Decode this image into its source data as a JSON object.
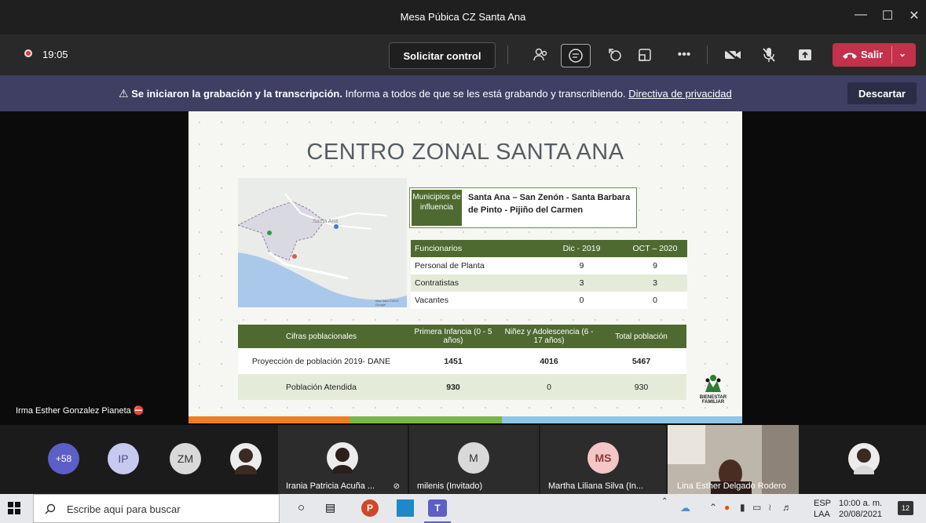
{
  "window": {
    "title": "Mesa Púbica CZ Santa Ana"
  },
  "toolbar": {
    "timer": "19:05",
    "request_control": "Solicitar control",
    "leave": "Salir"
  },
  "banner": {
    "bold": "Se iniciaron la grabación y la transcripción.",
    "text": "Informa a todos de que se les está grabando y transcribiendo.",
    "link": "Directiva de privacidad",
    "dismiss": "Descartar"
  },
  "slide": {
    "title": "CENTRO ZONAL SANTA ANA",
    "municipios_label": "Municipios de influencia",
    "municipios_value": "Santa Ana – San Zenón - Santa Barbara de Pinto - Pijiño del Carmen",
    "map_credit": "Map data ©2019 Google",
    "map_labels": [
      "Santa Ana"
    ],
    "funcionarios": {
      "headers": [
        "Funcionarios",
        "Dic - 2019",
        "OCT – 2020"
      ],
      "rows": [
        [
          "Personal de Planta",
          "9",
          "9"
        ],
        [
          "Contratistas",
          "3",
          "3"
        ],
        [
          "Vacantes",
          "0",
          "0"
        ]
      ]
    },
    "cifras": {
      "headers": [
        "Cifras poblacionales",
        "Primera Infancia (0 - 5 años)",
        "Niñez y Adolescencia (6 - 17 años)",
        "Total población"
      ],
      "rows": [
        [
          "Proyección de población 2019- DANE",
          "1451",
          "4016",
          "5467"
        ],
        [
          "Población Atendida",
          "930",
          "0",
          "930"
        ]
      ]
    },
    "logo_text": "BIENESTAR FAMILIAR"
  },
  "presenter_name": "Irma Esther Gonzalez Pianeta",
  "gallery": {
    "overflow": "+58",
    "initials": [
      "IP",
      "ZM",
      "M",
      "MS"
    ],
    "tiles": [
      "Irania Patricia Acuña ...",
      "milenis (Invitado)",
      "Martha Liliana Silva (In...",
      "Lina Esther Delgado Rodero"
    ]
  },
  "taskbar": {
    "search_placeholder": "Escribe aquí para buscar",
    "lang1": "ESP",
    "lang2": "LAA",
    "time": "10:00 a. m.",
    "date": "20/08/2021",
    "notifications": "12"
  },
  "colors": {
    "accent_green": "#4e6a30",
    "leave_red": "#c4314b",
    "banner": "#3e3f63"
  }
}
